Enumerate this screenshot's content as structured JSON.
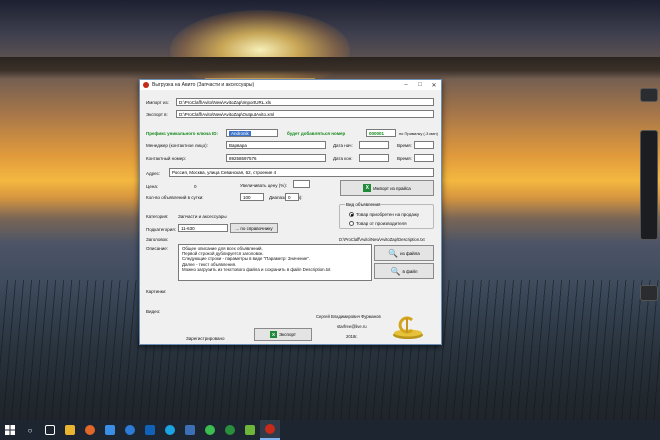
{
  "window": {
    "title": "Выгрузка на Авито (Запчасти и аксессуары)",
    "buttons": [
      "–",
      "□",
      "✕"
    ]
  },
  "form": {
    "import_label": "Импорт из:",
    "import_path": "D:\\ProClaff\\Avito\\New\\AvitoZap\\ImportURL.xls",
    "export_label": "Экспорт в:",
    "export_path": "D:\\ProClaff\\Avito\\New\\AvitoZap\\OutputAvito.xml",
    "prefix_label": "Префикс уникального ключа ID:",
    "prefix_value": "Andronik",
    "added_number_label": "будет добавляться номер",
    "added_number_value": "000001",
    "per_list_label": "по Привилку (-3 мин)",
    "manager_label": "Менеджер (контактное лицо):",
    "manager_value": "Варвара",
    "date_start_label": "Дата нач:",
    "time_label_1": "Время:",
    "phone_label": "Контактный номер:",
    "phone_value": "89258597576",
    "date_end_label": "Дата кон:",
    "time_label_2": "Время:",
    "address_label": "Адрес:",
    "address_value": "Россия, Москва, улица Севанская, 62, строение 4",
    "price_label": "Цена:",
    "price_value": "0",
    "increase_label": "Увеличивать цену (%):",
    "ads_per_day_label": "Кол-во объявлений в сутки:",
    "ads_per_day_value": "100",
    "range_label": "Диапазон (мин):",
    "range_value": "0",
    "import_price_button": "Импорт из прайса",
    "ad_type_group": "Вид объявления",
    "radio_sale": "Товар приобретен на продажу",
    "radio_manufacturer": "Товар от производителя",
    "category_label": "Категория:",
    "category_value": "Запчасти и аксессуары",
    "subcategory_label": "Подкатегория:",
    "subcategory_value": "11-630",
    "dictionary_button": "... по справочнику",
    "title_label": "Заголовок:",
    "description_path": "D:\\ProClaff\\Avito\\New\\AvitoZap\\Description.txt",
    "description_label": "Описание:",
    "description_lines": [
      "Общее описание для всех объявлений.",
      "Первой строкой дублируется заголовок.",
      "Следующие строки - параметры в виде \"Параметр: Значение\".",
      "Далее - текст объявления.",
      "Можно загрузить из текстового файла и сохранить в файл Description.txt"
    ],
    "from_file_button": "из файла",
    "to_file_button": "в файл",
    "pictures_label": "Картинки:",
    "video_label": "Видео:",
    "author_name": "Сергей Владимирович Фурманов",
    "author_email": "starfree@live.ru",
    "author_year": "2018г.",
    "status": "Зарегистрировано",
    "export_button": "Экспорт"
  },
  "taskbar": {
    "items": [
      "start",
      "search",
      "task-view",
      "file-explorer",
      "firefox",
      "store",
      "edge",
      "mail",
      "skype",
      "app-s",
      "whatsapp",
      "app-green",
      "app-flower",
      "avito-exporter"
    ]
  },
  "colors": {
    "accent": "#138a1b",
    "selection": "#3d74c9",
    "taskbar": "#1d2630"
  }
}
